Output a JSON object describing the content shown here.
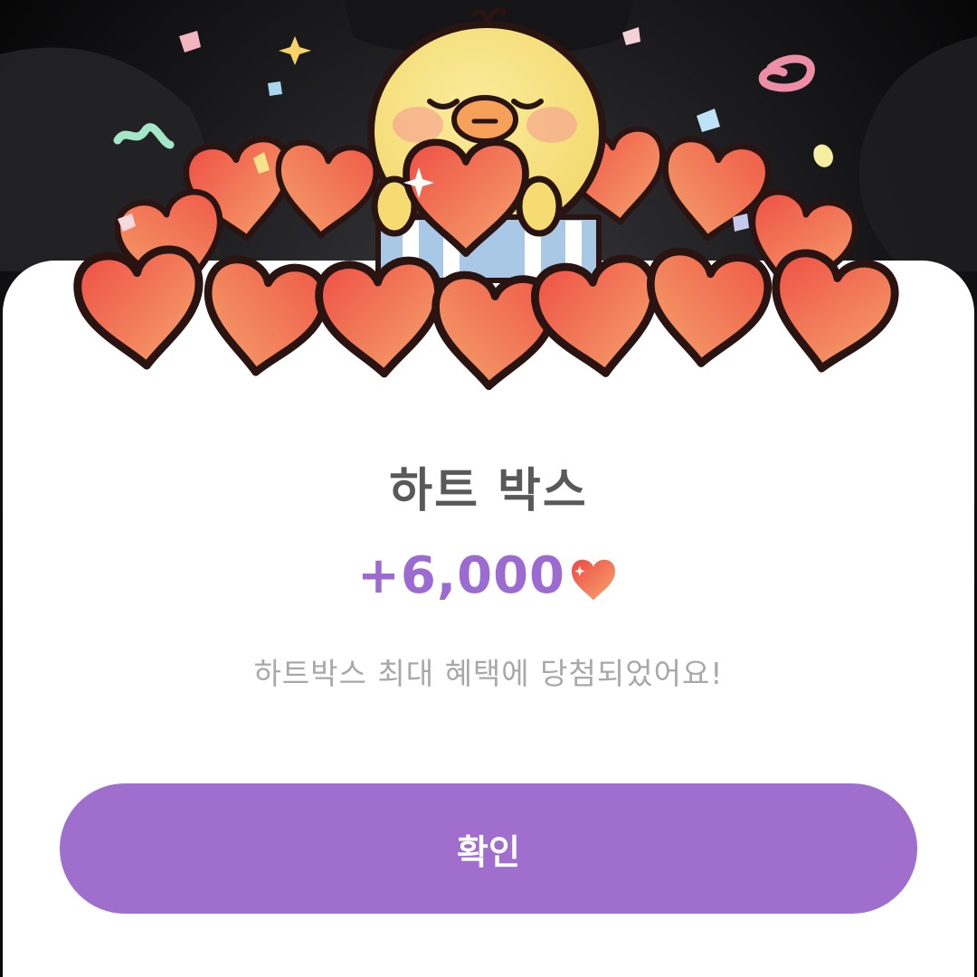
{
  "dialog": {
    "title": "하트 박스",
    "reward_amount": "+6,000",
    "reward_icon": "heart-icon",
    "description": "하트박스 최대 혜택에 당첨되었어요!",
    "confirm_label": "확인"
  },
  "illustration": {
    "subject": "chick-mascot-holding-heart-on-heart-pile",
    "icons": [
      "heart-icon",
      "confetti-icon",
      "sparkle-icon",
      "gift-box-icon"
    ]
  },
  "colors": {
    "accent_purple": "#9b6bd1",
    "button_purple": "#a06fce",
    "title_gray": "#595959",
    "desc_gray": "#a8a8a8",
    "heart_red": "#ee5a4a",
    "heart_orange": "#f5a06a",
    "chick_yellow": "#f9e48a"
  }
}
